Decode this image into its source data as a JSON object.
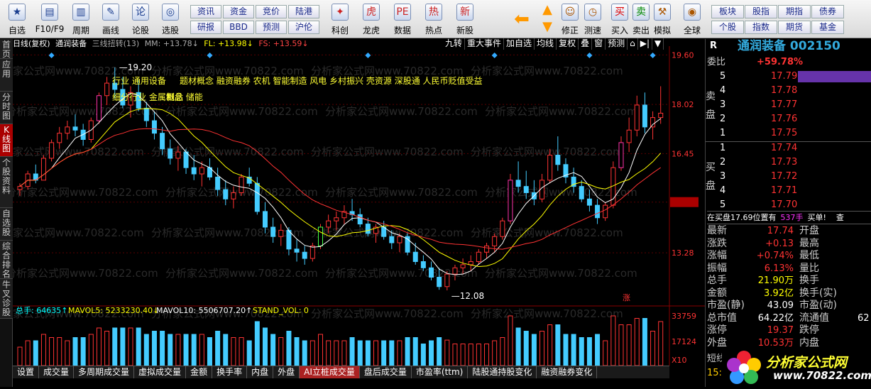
{
  "toolbar": {
    "buttons": [
      {
        "label": "自选",
        "icon": "★"
      },
      {
        "label": "F10/F9",
        "icon": "▤"
      },
      {
        "label": "周期",
        "icon": "▥"
      },
      {
        "label": "画线",
        "icon": "✎"
      },
      {
        "label": "论股",
        "icon": "论"
      },
      {
        "label": "选股",
        "icon": "◎"
      }
    ],
    "small_buttons": [
      "资讯",
      "资金",
      "竞价",
      "陆港",
      "研报",
      "BBD",
      "预测",
      "沪伦"
    ],
    "buttons2": [
      {
        "label": "科创",
        "icon": "✦"
      },
      {
        "label": "龙虎",
        "icon": "虎"
      },
      {
        "label": "数据",
        "icon": "PE"
      },
      {
        "label": "热点",
        "icon": "热"
      },
      {
        "label": "新股",
        "icon": "新"
      }
    ],
    "buttons3": [
      {
        "label": "修正",
        "icon": "☺"
      },
      {
        "label": "测速",
        "icon": "◷"
      },
      {
        "label": "买入",
        "icon": "买"
      },
      {
        "label": "卖出",
        "icon": "卖"
      },
      {
        "label": "模拟",
        "icon": "⚒"
      },
      {
        "label": "全球",
        "icon": "◉"
      }
    ],
    "small_buttons2": [
      "板块",
      "股指",
      "期指",
      "债券",
      "个股",
      "指数",
      "期货",
      "基金"
    ]
  },
  "sidebar": [
    "首页",
    "应用",
    "分时图",
    "K线图",
    "个股资料",
    "自选股",
    "综合排名",
    "牛叉诊股"
  ],
  "kline": {
    "header": {
      "title": "日线(复权)",
      "name": "通润装备",
      "ind": "三线扭转(13)",
      "mm": "MM: +13.78↓",
      "fl": "FL: +13.98↓",
      "fs": "FS: +13.59↓"
    },
    "tools": [
      "九转",
      "重大事件",
      "加自选",
      "均线",
      "复权",
      "叠",
      "窗",
      "预测"
    ],
    "tags": [
      "行业 通用设备",
      "题材概念 融资融券 农机 智能制造 风电 乡村振兴 壳资源 深股通 人民币贬值受益",
      "细分行业 金属制品",
      "概念 储能"
    ],
    "price_axis": [
      "19.60",
      "18.02",
      "16.45",
      "14.90",
      "13.28"
    ],
    "current_price_tag": "14.90",
    "high_label": "19.20",
    "low_label": "12.08",
    "zhang_mark": "涨",
    "watermark": "分析家公式网www.70822.com"
  },
  "volume": {
    "header": {
      "total": "总手: 64635↑",
      "mavol5": "MAVOL5: 5233230.40↓",
      "mavol10": "MAVOL10: 5506707.20↑",
      "stand": "STAND_VOL: 0"
    },
    "axis": [
      "33759",
      "17124",
      "X10"
    ]
  },
  "bottom_tabs": [
    "设置",
    "成交量",
    "多周期成交量",
    "虚拟成交量",
    "金额",
    "换手率",
    "内盘",
    "外盘",
    "AI立桩成交量",
    "盘后成交量",
    "市盈率(ttm)",
    "陆股通持股变化",
    "融资融券变化"
  ],
  "right": {
    "title": "通润装备 002150",
    "r_label": "R",
    "weibi_label": "委比",
    "weibi": "+59.78%",
    "sell": [
      {
        "n": "5",
        "p": "17.79"
      },
      {
        "n": "4",
        "p": "17.78"
      },
      {
        "n": "3",
        "p": "17.77"
      },
      {
        "n": "2",
        "p": "17.76"
      },
      {
        "n": "1",
        "p": "17.75"
      }
    ],
    "buy": [
      {
        "n": "1",
        "p": "17.74"
      },
      {
        "n": "2",
        "p": "17.73"
      },
      {
        "n": "3",
        "p": "17.72"
      },
      {
        "n": "4",
        "p": "17.71"
      },
      {
        "n": "5",
        "p": "17.70"
      }
    ],
    "sell_label": "卖盘",
    "buy_label": "买盘",
    "notice": "在买盘17.69位置有",
    "notice_vol": "537手",
    "notice_act": "买单!",
    "notice_q": "查",
    "quotes": [
      {
        "l": "最新",
        "v": "17.74",
        "l2": "开盘",
        "v2": ""
      },
      {
        "l": "涨跌",
        "v": "+0.13",
        "l2": "最高",
        "v2": ""
      },
      {
        "l": "涨幅",
        "v": "+0.74%",
        "l2": "最低",
        "v2": ""
      },
      {
        "l": "振幅",
        "v": "6.13%",
        "l2": "量比",
        "v2": ""
      },
      {
        "l": "总手",
        "v": "21.90万",
        "l2": "换手",
        "v2": ""
      },
      {
        "l": "金额",
        "v": "3.92亿",
        "l2": "换手(实)",
        "v2": ""
      },
      {
        "l": "市盈(静)",
        "v": "43.09",
        "l2": "市盈(动)",
        "v2": ""
      },
      {
        "l": "总市值",
        "v": "64.22亿",
        "l2": "流通值",
        "v2": "62"
      },
      {
        "l": "涨停",
        "v": "19.37",
        "l2": "跌停",
        "v2": ""
      },
      {
        "l": "外盘",
        "v": "10.53万",
        "l2": "内盘",
        "v2": ""
      }
    ],
    "short": "短线",
    "time": "15:0"
  },
  "logo": {
    "text": "分析家公式网",
    "url": "www.70822.com"
  },
  "chart_data": {
    "type": "candlestick",
    "price_range": [
      11.9,
      19.7
    ],
    "high": "19.20",
    "low": "12.08",
    "ohlc": [
      [
        15.3,
        15.5,
        15.1,
        15.4
      ],
      [
        15.4,
        15.9,
        15.3,
        15.8
      ],
      [
        15.8,
        16.1,
        15.5,
        15.6
      ],
      [
        15.6,
        16.4,
        15.6,
        16.3
      ],
      [
        16.3,
        16.9,
        16.2,
        16.8
      ],
      [
        16.8,
        17.3,
        16.6,
        17.1
      ],
      [
        17.1,
        17.5,
        16.9,
        17.3
      ],
      [
        17.3,
        17.7,
        17.0,
        17.2
      ],
      [
        17.2,
        17.4,
        16.7,
        16.9
      ],
      [
        16.9,
        17.6,
        16.8,
        17.5
      ],
      [
        17.5,
        18.4,
        17.4,
        18.3
      ],
      [
        18.3,
        18.9,
        18.0,
        18.7
      ],
      [
        18.7,
        19.2,
        18.2,
        18.5
      ],
      [
        18.5,
        18.9,
        17.9,
        18.0
      ],
      [
        18.0,
        18.6,
        17.6,
        18.4
      ],
      [
        18.4,
        18.8,
        17.8,
        17.9
      ],
      [
        17.9,
        18.1,
        17.3,
        17.5
      ],
      [
        17.5,
        17.8,
        16.9,
        17.1
      ],
      [
        17.1,
        17.3,
        16.4,
        16.6
      ],
      [
        16.6,
        16.9,
        16.1,
        16.3
      ],
      [
        16.3,
        16.7,
        15.9,
        16.5
      ],
      [
        16.5,
        16.6,
        15.8,
        16.0
      ],
      [
        16.0,
        16.4,
        15.6,
        15.8
      ],
      [
        15.8,
        16.2,
        15.4,
        16.0
      ],
      [
        16.0,
        16.3,
        15.6,
        15.7
      ],
      [
        15.7,
        16.0,
        15.1,
        15.3
      ],
      [
        15.3,
        15.6,
        14.8,
        15.0
      ],
      [
        15.0,
        15.4,
        14.7,
        15.2
      ],
      [
        15.2,
        15.8,
        15.1,
        15.7
      ],
      [
        15.7,
        16.0,
        15.4,
        15.5
      ],
      [
        15.5,
        15.7,
        14.5,
        14.6
      ],
      [
        14.6,
        14.9,
        13.9,
        14.1
      ],
      [
        14.1,
        14.4,
        13.6,
        13.8
      ],
      [
        13.8,
        14.2,
        13.5,
        14.0
      ],
      [
        14.0,
        14.1,
        13.2,
        13.4
      ],
      [
        13.4,
        13.7,
        13.0,
        13.3
      ],
      [
        13.3,
        13.5,
        12.9,
        13.1
      ],
      [
        13.1,
        13.6,
        13.0,
        13.5
      ],
      [
        13.5,
        14.2,
        13.4,
        14.1
      ],
      [
        14.1,
        14.5,
        13.9,
        14.3
      ],
      [
        14.3,
        14.6,
        14.0,
        14.4
      ],
      [
        14.4,
        14.8,
        14.2,
        14.6
      ],
      [
        14.6,
        15.0,
        14.3,
        14.5
      ],
      [
        14.5,
        14.7,
        14.1,
        14.2
      ],
      [
        14.2,
        14.4,
        13.8,
        13.9
      ],
      [
        13.9,
        14.2,
        13.6,
        14.1
      ],
      [
        14.1,
        14.3,
        13.7,
        13.8
      ],
      [
        13.8,
        14.0,
        13.4,
        13.6
      ],
      [
        13.6,
        13.9,
        13.3,
        13.8
      ],
      [
        13.8,
        13.9,
        13.2,
        13.3
      ],
      [
        13.3,
        13.6,
        12.9,
        13.0
      ],
      [
        13.0,
        13.2,
        12.7,
        12.8
      ],
      [
        12.8,
        13.0,
        12.4,
        12.5
      ],
      [
        12.5,
        12.8,
        12.1,
        12.2
      ],
      [
        12.2,
        12.7,
        12.08,
        12.6
      ],
      [
        12.6,
        12.9,
        12.4,
        12.8
      ],
      [
        12.8,
        13.1,
        12.6,
        12.9
      ],
      [
        12.9,
        13.2,
        12.7,
        13.0
      ],
      [
        13.0,
        13.4,
        12.9,
        13.3
      ],
      [
        13.3,
        13.6,
        13.1,
        13.5
      ],
      [
        13.5,
        13.9,
        13.3,
        13.8
      ],
      [
        13.8,
        14.4,
        13.7,
        14.3
      ],
      [
        14.3,
        15.8,
        14.2,
        15.6
      ],
      [
        15.6,
        16.2,
        15.2,
        15.4
      ],
      [
        15.4,
        15.9,
        15.0,
        15.2
      ],
      [
        15.2,
        15.6,
        14.8,
        15.0
      ],
      [
        15.0,
        15.8,
        14.9,
        15.6
      ],
      [
        15.6,
        16.6,
        15.5,
        16.4
      ],
      [
        16.4,
        17.0,
        15.9,
        16.1
      ],
      [
        16.1,
        16.3,
        15.5,
        15.7
      ],
      [
        15.7,
        16.0,
        15.2,
        15.4
      ],
      [
        15.4,
        15.6,
        14.9,
        15.0
      ],
      [
        15.0,
        15.3,
        14.6,
        14.8
      ],
      [
        14.8,
        15.0,
        14.2,
        14.4
      ],
      [
        14.4,
        14.9,
        14.3,
        14.8
      ],
      [
        14.8,
        16.2,
        14.7,
        16.0
      ],
      [
        16.0,
        17.0,
        15.9,
        16.8
      ],
      [
        16.8,
        17.6,
        16.5,
        17.2
      ],
      [
        17.2,
        18.3,
        17.0,
        18.0
      ],
      [
        18.0,
        18.4,
        17.1,
        17.3
      ],
      [
        17.3,
        17.8,
        16.9,
        17.6
      ],
      [
        17.6,
        18.6,
        17.4,
        17.74
      ]
    ]
  }
}
